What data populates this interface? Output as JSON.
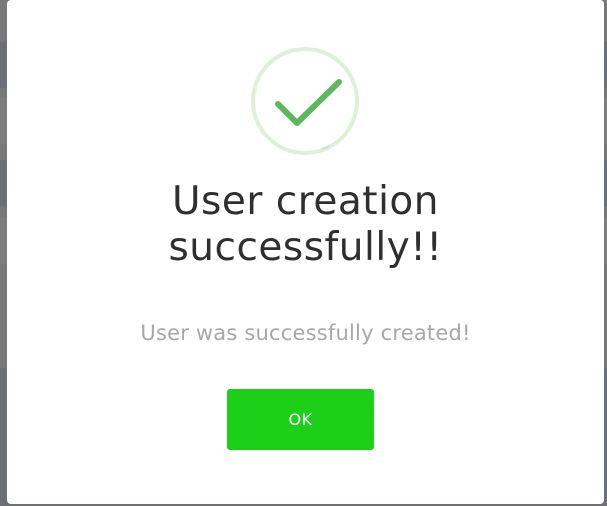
{
  "dialog": {
    "title_line1": "User creation",
    "title_line2": "successfully!!",
    "message": "User was successfully created!",
    "ok_label": "OK",
    "icon": "success-checkmark-icon"
  },
  "colors": {
    "success_green": "#5cb85c",
    "ring_color": "#dff0d8",
    "button_green": "#1cd01a",
    "title_text": "#2f2f2f",
    "message_text": "#a7a7a7",
    "backdrop": "#787878"
  }
}
